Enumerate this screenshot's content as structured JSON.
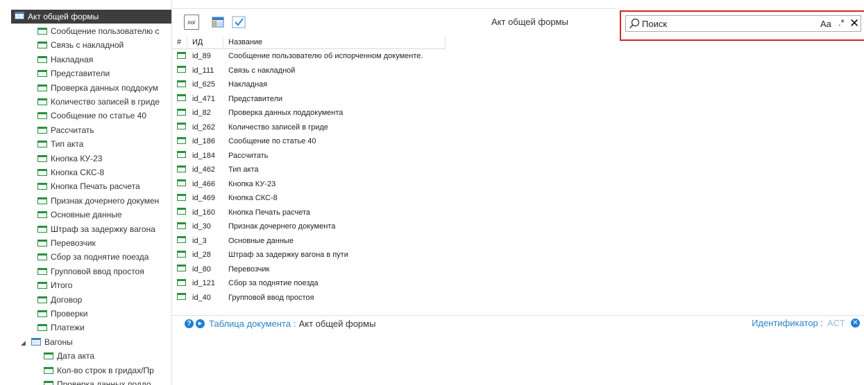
{
  "tree": {
    "root_label": "Акт общей формы",
    "items": [
      "Сообщение пользователю с",
      "Связь с накладной",
      "Накладная",
      "Представители",
      "Проверка данных поддокум",
      "Количество записей в гриде",
      "Сообщение по статье 40",
      "Рассчитать",
      "Тип акта",
      "Кнопка КУ-23",
      "Кнопка СКС-8",
      "Кнопка Печать расчета",
      "Признак дочернего докумен",
      "Основные данные",
      "Штраф за задержку вагона",
      "Перевозчик",
      "Сбор за поднятие поезда",
      "Групповой ввод простоя",
      "Итого",
      "Договор",
      "Проверки",
      "Платежи"
    ],
    "subtable_label": "Вагоны",
    "subitems": [
      "Дата акта",
      "Кол-во строк в гридах/Пр",
      "Проверка данных поддо"
    ]
  },
  "toolbar": {
    "log_label": "лог",
    "form_title": "Акт общей формы"
  },
  "search": {
    "placeholder": "Поиск",
    "case_label": "Aa",
    "regex_label": ".*",
    "close_label": "✕"
  },
  "table": {
    "headers": {
      "num": "#",
      "id": "ИД",
      "name": "Название"
    },
    "rows": [
      {
        "id": "id_89",
        "name": "Сообщение пользователю об испорченном документе."
      },
      {
        "id": "id_111",
        "name": "Связь с накладной"
      },
      {
        "id": "id_625",
        "name": "Накладная"
      },
      {
        "id": "id_471",
        "name": "Представители"
      },
      {
        "id": "id_82",
        "name": "Проверка данных поддокумента"
      },
      {
        "id": "id_262",
        "name": "Количество записей в гриде"
      },
      {
        "id": "id_186",
        "name": "Сообщение по статье 40"
      },
      {
        "id": "id_184",
        "name": "Рассчитать"
      },
      {
        "id": "id_462",
        "name": "Тип акта"
      },
      {
        "id": "id_466",
        "name": "Кнопка КУ-23"
      },
      {
        "id": "id_469",
        "name": "Кнопка СКС-8"
      },
      {
        "id": "id_160",
        "name": "Кнопка Печать расчета"
      },
      {
        "id": "id_30",
        "name": "Признак дочернего документа"
      },
      {
        "id": "id_3",
        "name": "Основные данные"
      },
      {
        "id": "id_28",
        "name": "Штраф за задержку вагона в пути"
      },
      {
        "id": "id_80",
        "name": "Перевозчик"
      },
      {
        "id": "id_121",
        "name": "Сбор за поднятие поезда"
      },
      {
        "id": "id_40",
        "name": "Групповой ввод простоя"
      }
    ]
  },
  "footer": {
    "help_icon": "?",
    "nav_icon": "▶",
    "link_label": "Таблица документа",
    "separator": ":",
    "table_name": "Акт общей формы",
    "identifier_label": "Идентификатор :",
    "identifier_value": "ACT",
    "clear_icon": "✕"
  },
  "colors": {
    "selection_bg": "#3d3d3d",
    "accent_blue": "#2c82c9",
    "search_highlight": "#d62525",
    "form_icon_green": "#2a8f3e"
  }
}
